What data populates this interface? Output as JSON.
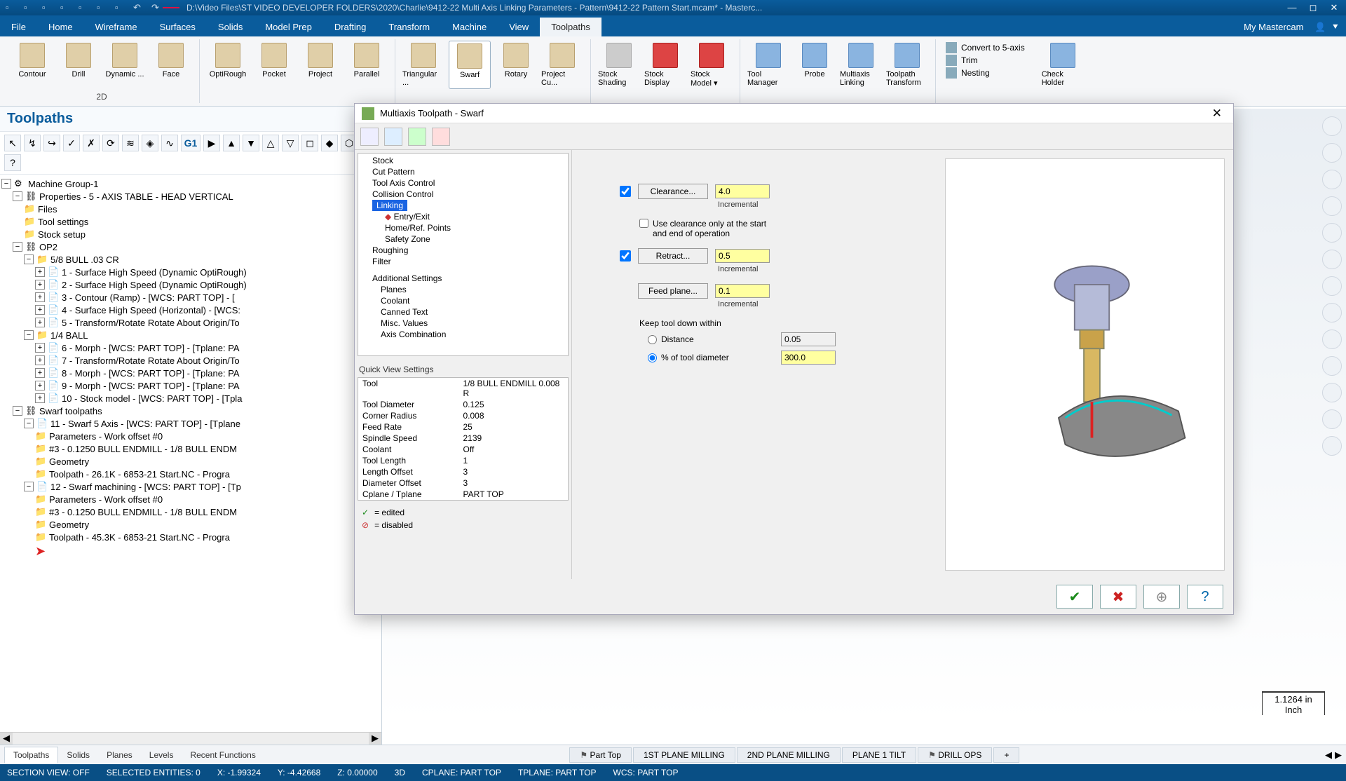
{
  "title": {
    "filepath": "D:\\Video Files\\ST VIDEO DEVELOPER FOLDERS\\2020\\Charlie\\9412-22 Multi Axis Linking Parameters - Pattern\\9412-22 Pattern Start.mcam* - Masterc...",
    "version": ""
  },
  "tabs": {
    "file": "File",
    "home": "Home",
    "wireframe": "Wireframe",
    "surfaces": "Surfaces",
    "solids": "Solids",
    "modelprep": "Model Prep",
    "drafting": "Drafting",
    "transform": "Transform",
    "machine": "Machine",
    "view": "View",
    "toolpaths": "Toolpaths",
    "mymc": "My Mastercam"
  },
  "ribbon": {
    "g2d": {
      "contour": "Contour",
      "drill": "Drill",
      "dynamic": "Dynamic ...",
      "face": "Face",
      "label": "2D"
    },
    "g3d": {
      "optirough": "OptiRough",
      "pocket": "Pocket",
      "project": "Project",
      "parallel": "Parallel"
    },
    "gma": {
      "triangular": "Triangular ...",
      "swarf": "Swarf",
      "rotary": "Rotary",
      "projectcu": "Project Cu..."
    },
    "gstock": {
      "shading": "Stock Shading",
      "display": "Stock Display",
      "model": "Stock Model ▾"
    },
    "gutil": {
      "tool": "Tool Manager",
      "probe": "Probe",
      "link": "Multiaxis Linking",
      "tptrans": "Toolpath Transform"
    },
    "gchk": {
      "conv5": "Convert to 5-axis",
      "trim": "Trim",
      "nesting": "Nesting",
      "check": "Check Holder"
    }
  },
  "left": {
    "header": "Toolpaths",
    "g1": "G1"
  },
  "tree": {
    "mg": "Machine Group-1",
    "props": "Properties - 5 - AXIS TABLE - HEAD VERTICAL",
    "files": "Files",
    "toolsettings": "Tool settings",
    "stocksetup": "Stock setup",
    "op2": "OP2",
    "bull": "5/8 BULL .03 CR",
    "op1": "1 - Surface High Speed (Dynamic OptiRough)",
    "op2b": "2 - Surface High Speed (Dynamic OptiRough)",
    "op3": "3 - Contour (Ramp) - [WCS: PART TOP] - [",
    "op4": "4 - Surface High Speed (Horizontal) - [WCS:",
    "op5": "5 - Transform/Rotate Rotate About Origin/To",
    "ball": "1/4 BALL",
    "op6": "6 - Morph - [WCS: PART TOP] - [Tplane: PA",
    "op7": "7 - Transform/Rotate Rotate About Origin/To",
    "op8": "8 - Morph - [WCS: PART TOP] - [Tplane: PA",
    "op9": "9 - Morph - [WCS: PART TOP] - [Tplane: PA",
    "op10": "10 - Stock model - [WCS: PART TOP] - [Tpla",
    "swarftp": "Swarf toolpaths",
    "op11": "11 - Swarf 5 Axis - [WCS: PART TOP] - [Tplane",
    "params1": "Parameters - Work offset #0",
    "tool1": "#3 - 0.1250 BULL ENDMILL - 1/8 BULL ENDM",
    "geom1": "Geometry",
    "tp1": "Toolpath - 26.1K - 6853-21 Start.NC - Progra",
    "op12": "12 - Swarf machining - [WCS: PART TOP] - [Tp",
    "params2": "Parameters - Work offset #0",
    "tool2": "#3 - 0.1250 BULL ENDMILL - 1/8 BULL ENDM",
    "geom2": "Geometry",
    "tp2": "Toolpath - 45.3K - 6853-21 Start.NC - Progra"
  },
  "dialog": {
    "title": "Multiaxis Toolpath - Swarf",
    "tree": {
      "stock": "Stock",
      "cutpattern": "Cut Pattern",
      "toolaxis": "Tool Axis Control",
      "collision": "Collision Control",
      "linking": "Linking",
      "entryexit": "Entry/Exit",
      "homeref": "Home/Ref. Points",
      "safety": "Safety Zone",
      "roughing": "Roughing",
      "filter": "Filter",
      "addl": "Additional Settings",
      "planes": "Planes",
      "coolant": "Coolant",
      "canned": "Canned Text",
      "misc": "Misc. Values",
      "axiscombo": "Axis Combination"
    },
    "qv": {
      "header": "Quick View Settings",
      "tool_k": "Tool",
      "tool_v": "1/8 BULL ENDMILL 0.008 R",
      "dia_k": "Tool Diameter",
      "dia_v": "0.125",
      "cr_k": "Corner Radius",
      "cr_v": "0.008",
      "fr_k": "Feed Rate",
      "fr_v": "25",
      "ss_k": "Spindle Speed",
      "ss_v": "2139",
      "cool_k": "Coolant",
      "cool_v": "Off",
      "tl_k": "Tool Length",
      "tl_v": "1",
      "lo_k": "Length Offset",
      "lo_v": "3",
      "do_k": "Diameter Offset",
      "do_v": "3",
      "cp_k": "Cplane / Tplane",
      "cp_v": "PART TOP"
    },
    "legend": {
      "edited": "= edited",
      "disabled": "= disabled"
    },
    "params": {
      "clearance": "Clearance...",
      "clearance_v": "4.0",
      "clearance_mode": "Incremental",
      "useclear": "Use clearance only at the start and end of operation",
      "retract": "Retract...",
      "retract_v": "0.5",
      "retract_mode": "Incremental",
      "feedplane": "Feed plane...",
      "feedplane_v": "0.1",
      "feedplane_mode": "Incremental",
      "ktd": "Keep tool down within",
      "distance": "Distance",
      "distance_v": "0.05",
      "pct": "% of tool diameter",
      "pct_v": "300.0"
    }
  },
  "bottomtabs": {
    "toolpaths": "Toolpaths",
    "solids": "Solids",
    "planes": "Planes",
    "levels": "Levels",
    "recent": "Recent Functions",
    "parttop": "Part Top",
    "p1": "1ST PLANE MILLING",
    "p2": "2ND PLANE MILLING",
    "p3": "PLANE 1 TILT",
    "p4": "DRILL OPS"
  },
  "status": {
    "section": "SECTION VIEW: OFF",
    "sel": "SELECTED ENTITIES: 0",
    "x": "X:   -1.99324",
    "y": "Y:   -4.42668",
    "z": "Z:   0.00000",
    "d": "3D",
    "cp": "CPLANE: PART TOP",
    "tp": "TPLANE: PART TOP",
    "wcs": "WCS: PART TOP"
  },
  "ruler": {
    "val": "1.1264 in",
    "unit": "Inch"
  }
}
